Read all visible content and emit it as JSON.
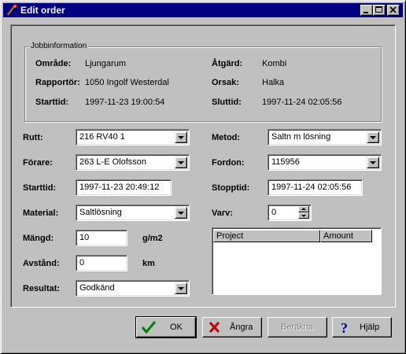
{
  "window": {
    "title": "Edit order"
  },
  "jobinfo": {
    "legend": "Jobbinformation",
    "omrade_label": "Område:",
    "omrade_value": "Ljungarum",
    "rapportor_label": "Rapportör:",
    "rapportor_value": "1050 Ingolf Westerdal",
    "starttid_label": "Starttid:",
    "starttid_value": "1997-11-23 19:00:54",
    "atgard_label": "Åtgärd:",
    "atgard_value": "Kombi",
    "orsak_label": "Orsak:",
    "orsak_value": "Halka",
    "sluttid_label": "Sluttid:",
    "sluttid_value": "1997-11-24 02:05:56"
  },
  "form": {
    "rutt_label": "Rutt:",
    "rutt_value": "216 RV40 1",
    "forare_label": "Förare:",
    "forare_value": "263 L-E Olofsson",
    "starttid_label": "Starttid:",
    "starttid_value": "1997-11-23 20:49:12",
    "material_label": "Material:",
    "material_value": "Saltlösning",
    "mangd_label": "Mängd:",
    "mangd_value": "10",
    "mangd_unit": "g/m2",
    "avstand_label": "Avstånd:",
    "avstand_value": "0",
    "avstand_unit": "km",
    "resultat_label": "Resultat:",
    "resultat_value": "Godkänd",
    "metod_label": "Metod:",
    "metod_value": "Saltn m lösning",
    "fordon_label": "Fordon:",
    "fordon_value": "115956",
    "stopptid_label": "Stopptid:",
    "stopptid_value": "1997-11-24 02:05:56",
    "varv_label": "Varv:",
    "varv_value": "0"
  },
  "listview": {
    "columns": [
      "Project",
      "Amount"
    ],
    "rows": []
  },
  "buttons": {
    "ok": "OK",
    "angra": "Ångra",
    "berakna": "Beräkna",
    "hjalp": "Hjälp"
  },
  "colors": {
    "titlebar": "#000080",
    "face": "#c0c0c0"
  }
}
